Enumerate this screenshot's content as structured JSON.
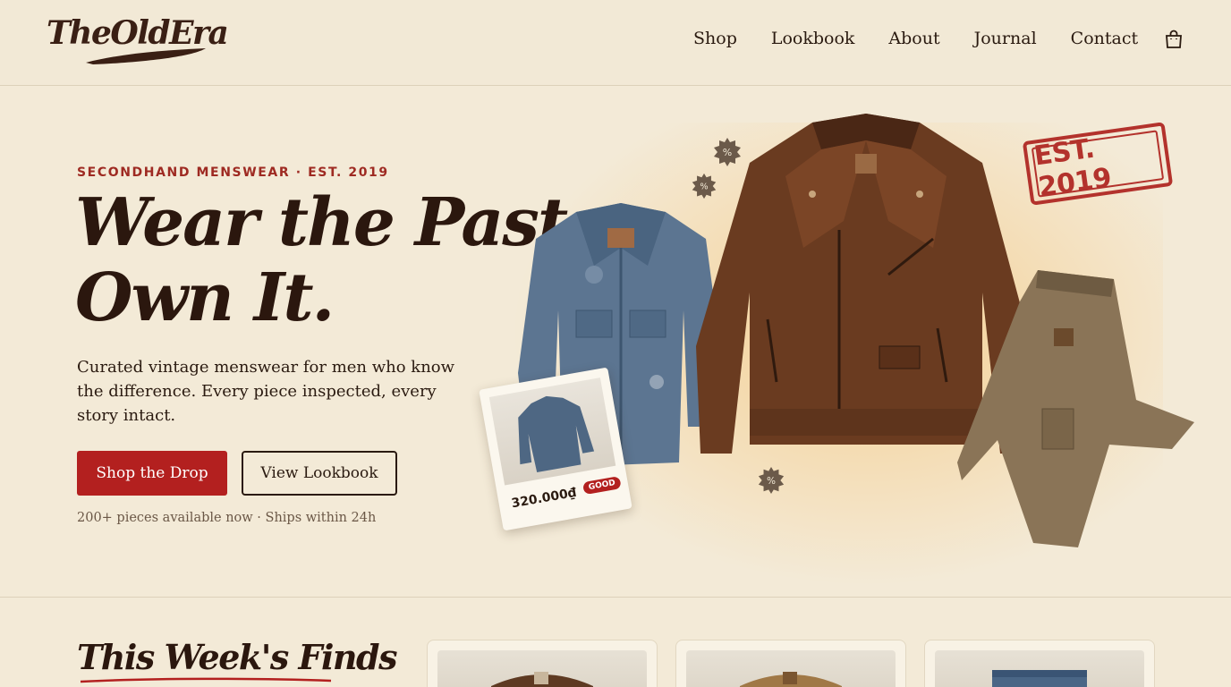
{
  "brand": {
    "name": "TheOldEra"
  },
  "nav": {
    "items": [
      {
        "label": "Shop"
      },
      {
        "label": "Lookbook"
      },
      {
        "label": "About"
      },
      {
        "label": "Journal"
      },
      {
        "label": "Contact"
      }
    ],
    "cart_icon": "shopping-bag-icon"
  },
  "hero": {
    "eyebrow": "SECONDHAND MENSWEAR · EST. 2019",
    "headline_line1": "Wear the Past.",
    "headline_line2": "Own It.",
    "subtext": "Curated vintage menswear for men who know the difference. Every piece inspected, every story intact.",
    "primary_cta": "Shop the Drop",
    "secondary_cta": "View Lookbook",
    "meta": "200+ pieces available now · Ships within 24h",
    "stamp": "EST. 2019",
    "polaroid": {
      "price": "320.000₫",
      "condition": "GOOD"
    }
  },
  "finds": {
    "title": "This Week's Finds",
    "cards": [
      {
        "image": "brown-jacket"
      },
      {
        "image": "tan-jacket"
      },
      {
        "image": "denim-jeans"
      }
    ]
  },
  "colors": {
    "background": "#f3ead7",
    "accent_red": "#b3201f",
    "text_dark": "#2a1a10"
  }
}
